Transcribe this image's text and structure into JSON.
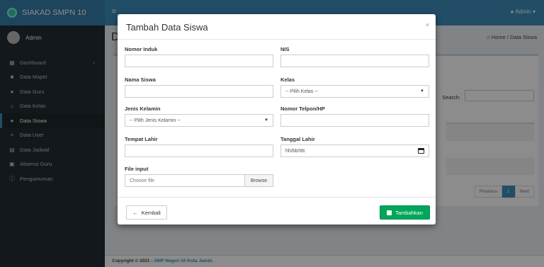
{
  "app": {
    "title": "SIAKAD SMPN 10",
    "user": "Admin",
    "topbar_user": "Admin"
  },
  "sidebar": {
    "items": [
      {
        "label": "Dashboard",
        "icon": "dashboard-icon"
      },
      {
        "label": "Data Mapel",
        "icon": "book-icon"
      },
      {
        "label": "Data Guru",
        "icon": "users-icon"
      },
      {
        "label": "Data Kelas",
        "icon": "home-icon"
      },
      {
        "label": "Data Siswa",
        "icon": "users-icon",
        "active": true
      },
      {
        "label": "Data User",
        "icon": "user-plus-icon"
      },
      {
        "label": "Data Jadwal",
        "icon": "calendar-icon"
      },
      {
        "label": "Absensi Guru",
        "icon": "calendar-check-icon"
      },
      {
        "label": "Pengumuman",
        "icon": "info-icon"
      }
    ]
  },
  "header": {
    "page_title_initial": "D",
    "breadcrumb_home": "Home",
    "breadcrumb_current": "Data Siswa"
  },
  "table": {
    "search_label": "Search:",
    "pagination": {
      "previous": "Previous",
      "page": "1",
      "next": "Next"
    }
  },
  "footer": {
    "text": "Copyright © 2021 - ",
    "link": "SMP Negeri 10 Kota Jambi."
  },
  "modal": {
    "title": "Tambah Data Siswa",
    "close": "×",
    "fields": {
      "nomor_induk": {
        "label": "Nomor Induk",
        "value": ""
      },
      "nis": {
        "label": "NIS",
        "value": ""
      },
      "nama_siswa": {
        "label": "Nama Siswa",
        "value": ""
      },
      "kelas": {
        "label": "Kelas",
        "selected": "-- Pilih Kelas --"
      },
      "jenis_kelamin": {
        "label": "Jenis Kelamin",
        "selected": "-- Pilih Jenis Kelamin --"
      },
      "nomor_telpon": {
        "label": "Nomor Telpon/HP",
        "value": ""
      },
      "tempat_lahir": {
        "label": "Tempat Lahir",
        "value": ""
      },
      "tanggal_lahir": {
        "label": "Tanggal Lahir",
        "placeholder": "hh/bb/tttt"
      },
      "file_input": {
        "label": "File input",
        "placeholder": "Choose file",
        "browse": "Browse"
      }
    },
    "back_button": "Kembali",
    "submit_button": "Tambahkan"
  },
  "colors": {
    "primary": "#3c8dbc",
    "sidebar": "#222d32",
    "success": "#00a65a"
  }
}
